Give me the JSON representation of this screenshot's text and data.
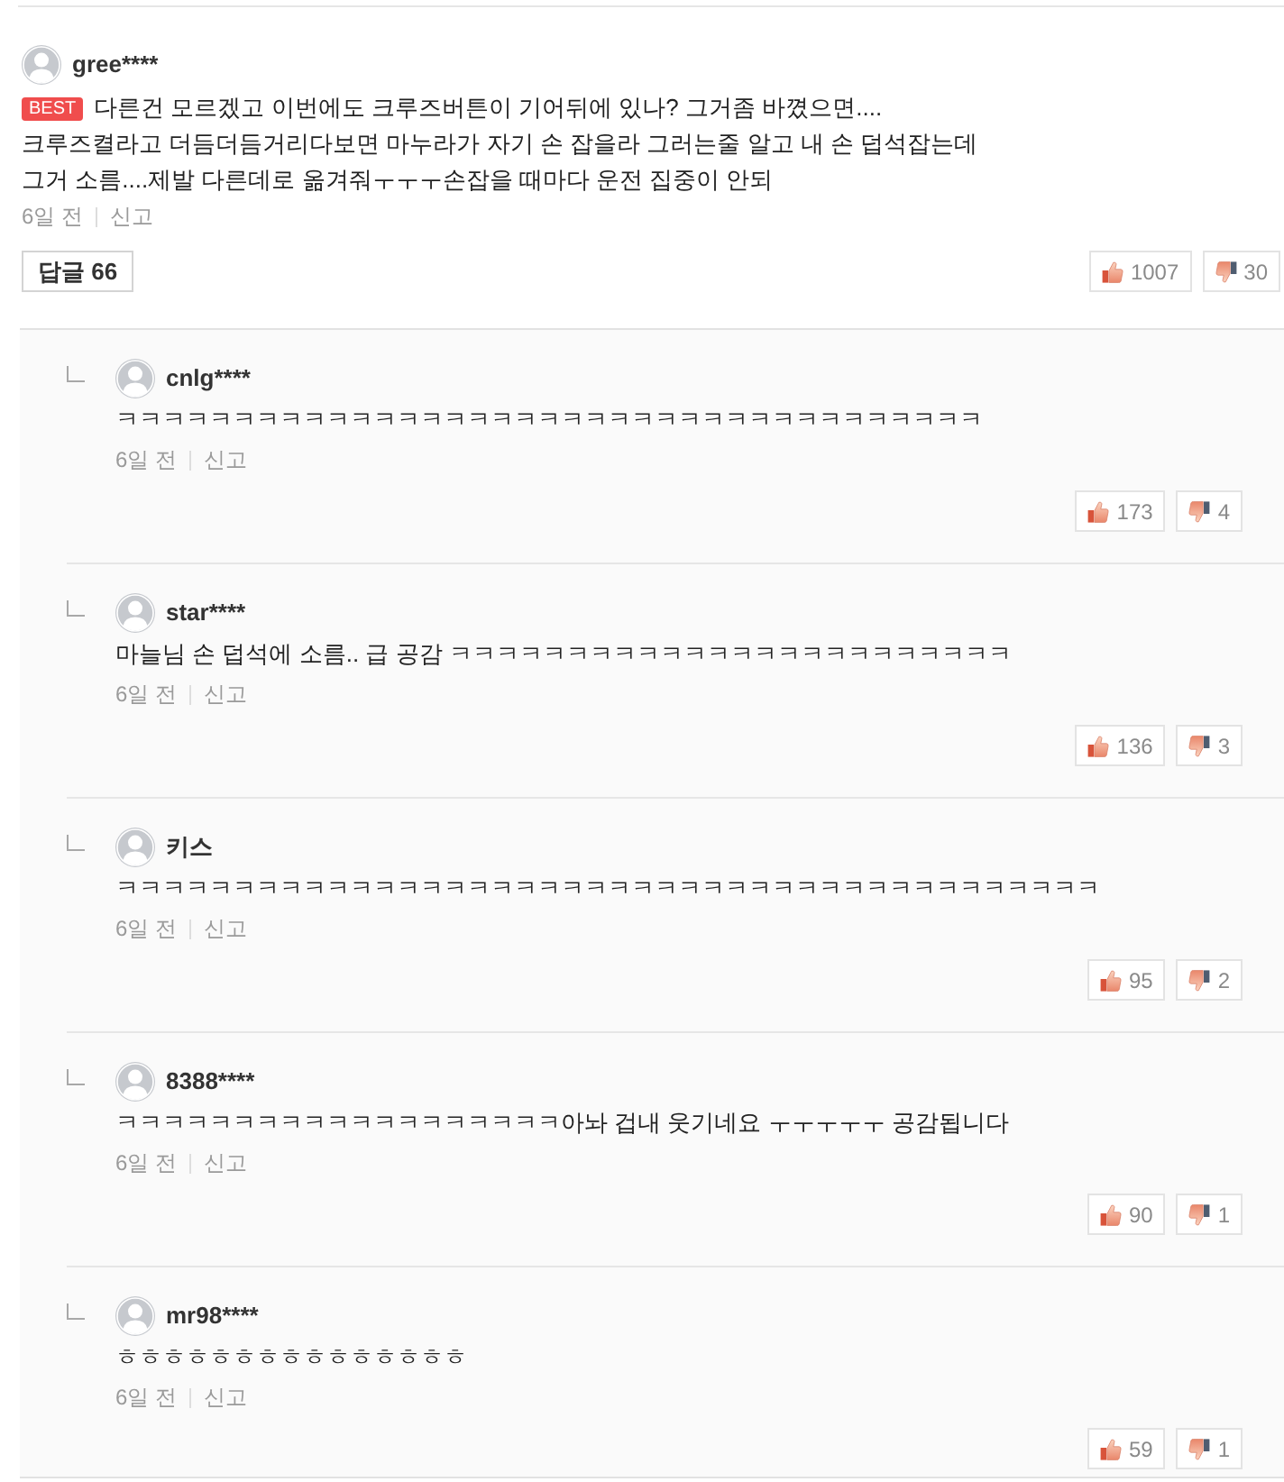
{
  "comment": {
    "username": "gree****",
    "badge": "BEST",
    "text_lines": [
      "다른건 모르겠고 이번에도 크루즈버튼이 기어뒤에 있나? 그거좀 바꼈으면....",
      "크루즈켤라고 더듬더듬거리다보면 마누라가 자기 손 잡을라 그러는줄 알고 내 손 덥석잡는데",
      "그거 소름....제발 다른데로 옮겨줘ㅜㅜㅜ손잡을 때마다 운전 집중이 안되"
    ],
    "time": "6일 전",
    "report": "신고",
    "reply_button": "답글 66",
    "likes": "1007",
    "dislikes": "30"
  },
  "replies": [
    {
      "username": "cnlg****",
      "text": "ㅋㅋㅋㅋㅋㅋㅋㅋㅋㅋㅋㅋㅋㅋㅋㅋㅋㅋㅋㅋㅋㅋㅋㅋㅋㅋㅋㅋㅋㅋㅋㅋㅋㅋㅋㅋㅋ",
      "time": "6일 전",
      "report": "신고",
      "likes": "173",
      "dislikes": "4"
    },
    {
      "username": "star****",
      "text": "마늘님 손 덥석에 소름.. 급 공감 ㅋㅋㅋㅋㅋㅋㅋㅋㅋㅋㅋㅋㅋㅋㅋㅋㅋㅋㅋㅋㅋㅋㅋㅋ",
      "time": "6일 전",
      "report": "신고",
      "likes": "136",
      "dislikes": "3"
    },
    {
      "username": "키스",
      "text": "ㅋㅋㅋㅋㅋㅋㅋㅋㅋㅋㅋㅋㅋㅋㅋㅋㅋㅋㅋㅋㅋㅋㅋㅋㅋㅋㅋㅋㅋㅋㅋㅋㅋㅋㅋㅋㅋㅋㅋㅋㅋㅋ",
      "time": "6일 전",
      "report": "신고",
      "likes": "95",
      "dislikes": "2"
    },
    {
      "username": "8388****",
      "text": "ㅋㅋㅋㅋㅋㅋㅋㅋㅋㅋㅋㅋㅋㅋㅋㅋㅋㅋㅋ아놔 겁내 웃기네요 ㅜㅜㅜㅜㅜ 공감됩니다",
      "time": "6일 전",
      "report": "신고",
      "likes": "90",
      "dislikes": "1"
    },
    {
      "username": "mr98****",
      "text": "ㅎㅎㅎㅎㅎㅎㅎㅎㅎㅎㅎㅎㅎㅎㅎ",
      "time": "6일 전",
      "report": "신고",
      "likes": "59",
      "dislikes": "1"
    }
  ]
}
